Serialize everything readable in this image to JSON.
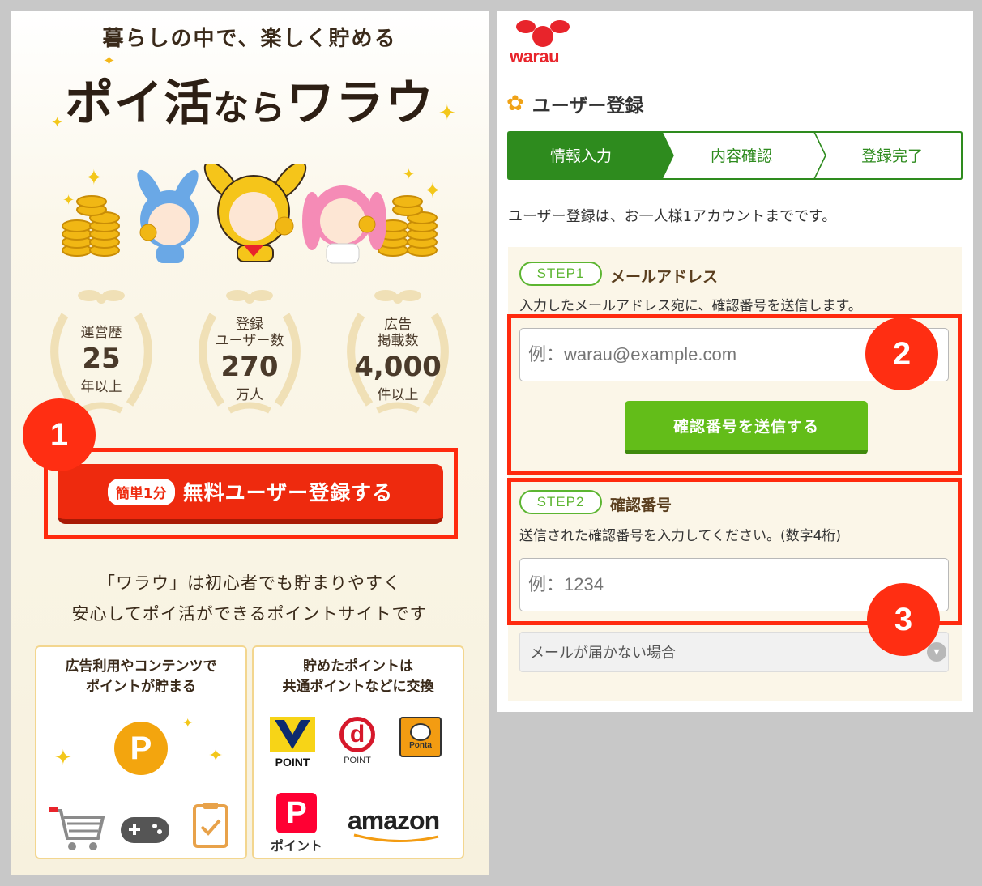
{
  "left": {
    "tagline": "暮らしの中で、楽しく貯める",
    "logo": {
      "part1": "ポイ活",
      "part2": "なら",
      "part3": "ワラウ"
    },
    "coin_mark": "P",
    "stats": [
      {
        "label": "運営歴",
        "number": "25",
        "unit": "年以上"
      },
      {
        "label1": "登録",
        "label2": "ユーザー数",
        "number": "270",
        "unit": "万人"
      },
      {
        "label1": "広告",
        "label2": "掲載数",
        "number": "4,000",
        "unit": "件以上"
      }
    ],
    "signup_button": {
      "pill": "簡単1分",
      "label": "無料ユーザー登録する"
    },
    "description": {
      "line1": "「ワラウ」は初心者でも貯まりやすく",
      "line2": "安心してポイ活ができるポイントサイトです"
    },
    "card_left": {
      "title1": "広告利用やコンテンツで",
      "title2": "ポイントが貯まる",
      "icons": [
        "point-icon",
        "cart-icon",
        "gamepad-icon",
        "clipboard-icon"
      ],
      "point_letter": "P"
    },
    "card_right": {
      "title1": "貯めたポイントは",
      "title2": "共通ポイントなどに交換",
      "logos": {
        "v_point": "POINT",
        "d_point": "POINT",
        "d_letter": "d",
        "ponta": "Ponta",
        "paypay": "ポイント",
        "amazon": "amazon"
      }
    }
  },
  "badges": [
    "1",
    "2",
    "3"
  ],
  "right": {
    "logo_text": "warau",
    "page_title": "ユーザー登録",
    "steps": [
      "情報入力",
      "内容確認",
      "登録完了"
    ],
    "note": "ユーザー登録は、お一人様1アカウントまでです。",
    "step1": {
      "tag": "STEP1",
      "name": "メールアドレス",
      "help": "入力したメールアドレス宛に、確認番号を送信します。",
      "placeholder": "例：warau@example.com",
      "button": "確認番号を送信する"
    },
    "step2": {
      "tag": "STEP2",
      "name": "確認番号",
      "help": "送信された確認番号を入力してください。(数字4桁)",
      "placeholder": "例：1234"
    },
    "nomail": "メールが届かない場合"
  },
  "colors": {
    "accent_red": "#ee2a0e",
    "highlight": "#ff2a0e",
    "green": "#63bd19",
    "step_green": "#2e8b1e",
    "gold": "#f1b714"
  }
}
